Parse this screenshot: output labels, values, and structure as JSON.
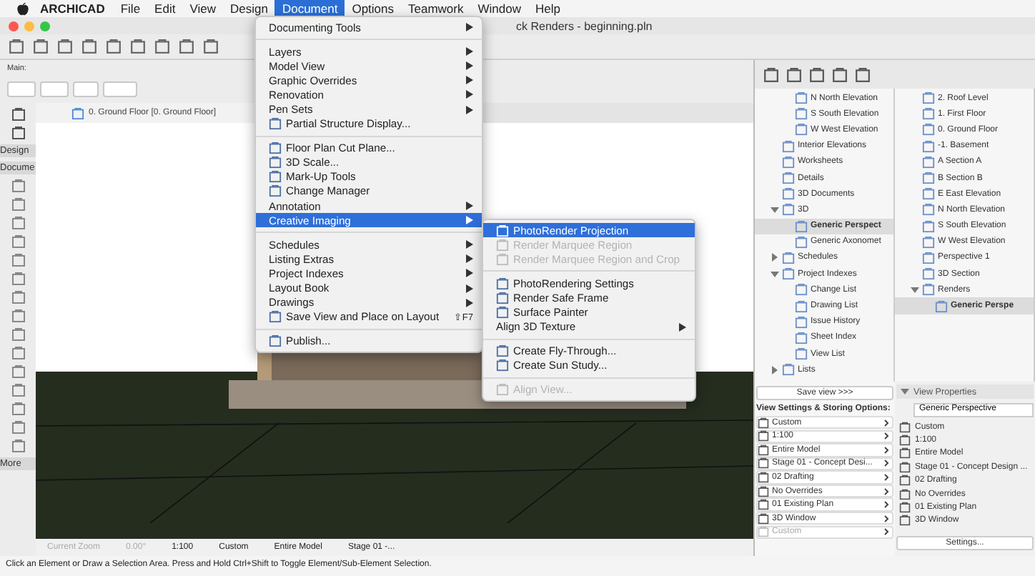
{
  "menubar": {
    "app": "ARCHICAD",
    "items": [
      {
        "label": "File",
        "selected": false
      },
      {
        "label": "Edit",
        "selected": false
      },
      {
        "label": "View",
        "selected": false
      },
      {
        "label": "Design",
        "selected": false
      },
      {
        "label": "Document",
        "selected": true
      },
      {
        "label": "Options",
        "selected": false
      },
      {
        "label": "Teamwork",
        "selected": false
      },
      {
        "label": "Window",
        "selected": false
      },
      {
        "label": "Help",
        "selected": false
      }
    ]
  },
  "window": {
    "title": "ck Renders - beginning.pln"
  },
  "toolbar": {
    "label": "Main:"
  },
  "toolbox": {
    "tabs": [
      "Design",
      "Docume"
    ],
    "more": "More"
  },
  "view_tab": {
    "label": "0. Ground Floor [0. Ground Floor]"
  },
  "nav_bar": {
    "items": [
      {
        "label": "Current Zoom",
        "disabled": true
      },
      {
        "label": "0.00°",
        "disabled": true
      },
      {
        "label": "1:100",
        "disabled": false
      },
      {
        "label": "Custom",
        "disabled": false
      },
      {
        "label": "Entire Model",
        "disabled": false
      },
      {
        "label": "Stage 01 -...",
        "disabled": false
      }
    ]
  },
  "status_bar": "Click an Element or Draw a Selection Area. Press and Hold Ctrl+Shift to Toggle Element/Sub-Element Selection.",
  "document_menu": {
    "items": [
      {
        "kind": "item",
        "label": "Documenting Tools",
        "submenu": true,
        "selected": false
      },
      {
        "kind": "separator"
      },
      {
        "kind": "item",
        "label": "Layers",
        "submenu": true,
        "selected": false
      },
      {
        "kind": "item",
        "label": "Model View",
        "submenu": true,
        "selected": false
      },
      {
        "kind": "item",
        "label": "Graphic Overrides",
        "submenu": true,
        "selected": false
      },
      {
        "kind": "item",
        "label": "Renovation",
        "submenu": true,
        "selected": false
      },
      {
        "kind": "item",
        "label": "Pen Sets",
        "submenu": true,
        "selected": false
      },
      {
        "kind": "icon_item",
        "label": "Partial Structure Display...",
        "submenu": false,
        "selected": false
      },
      {
        "kind": "separator"
      },
      {
        "kind": "icon_item",
        "label": "Floor Plan Cut Plane...",
        "submenu": false,
        "selected": false
      },
      {
        "kind": "icon_item",
        "label": "3D Scale...",
        "submenu": false,
        "selected": false
      },
      {
        "kind": "icon_item",
        "label": "Mark-Up Tools",
        "submenu": false,
        "selected": false
      },
      {
        "kind": "icon_item",
        "label": "Change Manager",
        "submenu": false,
        "selected": false
      },
      {
        "kind": "item",
        "label": "Annotation",
        "submenu": true,
        "selected": false
      },
      {
        "kind": "item",
        "label": "Creative Imaging",
        "submenu": true,
        "selected": true
      },
      {
        "kind": "separator"
      },
      {
        "kind": "item",
        "label": "Schedules",
        "submenu": true,
        "selected": false
      },
      {
        "kind": "item",
        "label": "Listing Extras",
        "submenu": true,
        "selected": false
      },
      {
        "kind": "item",
        "label": "Project Indexes",
        "submenu": true,
        "selected": false
      },
      {
        "kind": "item",
        "label": "Layout Book",
        "submenu": true,
        "selected": false
      },
      {
        "kind": "item",
        "label": "Drawings",
        "submenu": true,
        "selected": false
      },
      {
        "kind": "icon_item",
        "label": "Save View and Place on Layout",
        "submenu": false,
        "selected": false,
        "shortcut": "⇧F7"
      },
      {
        "kind": "separator"
      },
      {
        "kind": "icon_item",
        "label": "Publish...",
        "submenu": false,
        "selected": false
      }
    ]
  },
  "creative_imaging_submenu": {
    "items": [
      {
        "kind": "icon_item",
        "label": "PhotoRender Projection",
        "submenu": false,
        "selected": true,
        "disabled": false
      },
      {
        "kind": "icon_item",
        "label": "Render Marquee Region",
        "submenu": false,
        "selected": false,
        "disabled": true
      },
      {
        "kind": "icon_item",
        "label": "Render Marquee Region and Crop",
        "submenu": false,
        "selected": false,
        "disabled": true
      },
      {
        "kind": "separator"
      },
      {
        "kind": "icon_item",
        "label": "PhotoRendering Settings",
        "submenu": false,
        "selected": false,
        "disabled": false
      },
      {
        "kind": "icon_item",
        "label": "Render Safe Frame",
        "submenu": false,
        "selected": false,
        "disabled": false
      },
      {
        "kind": "icon_item",
        "label": "Surface Painter",
        "submenu": false,
        "selected": false,
        "disabled": false
      },
      {
        "kind": "item",
        "label": "Align 3D Texture",
        "submenu": true,
        "selected": false,
        "disabled": false
      },
      {
        "kind": "separator"
      },
      {
        "kind": "icon_item",
        "label": "Create Fly-Through...",
        "submenu": false,
        "selected": false,
        "disabled": false
      },
      {
        "kind": "icon_item",
        "label": "Create Sun Study...",
        "submenu": false,
        "selected": false,
        "disabled": false
      },
      {
        "kind": "separator"
      },
      {
        "kind": "icon_item",
        "label": "Align View...",
        "submenu": false,
        "selected": false,
        "disabled": true
      }
    ]
  },
  "view_map": {
    "continued": [
      {
        "label": "N North Elevation",
        "selected": false
      },
      {
        "label": "S South Elevation",
        "selected": false
      },
      {
        "label": "W West Elevation",
        "selected": false
      }
    ],
    "items": [
      {
        "label": "Interior Elevations",
        "selected": false
      },
      {
        "label": "Worksheets",
        "selected": false
      },
      {
        "label": "Details",
        "selected": false
      },
      {
        "label": "3D Documents",
        "selected": false
      },
      {
        "label": "3D",
        "selected": false,
        "expanded": true,
        "children": [
          {
            "label": "Generic Perspect",
            "selected": true
          },
          {
            "label": "Generic Axonomet",
            "selected": false
          }
        ]
      },
      {
        "label": "Schedules",
        "selected": false,
        "expanded": false
      },
      {
        "label": "Project Indexes",
        "selected": false,
        "expanded": true,
        "children": [
          {
            "label": "Change List",
            "selected": false
          },
          {
            "label": "Drawing List",
            "selected": false
          },
          {
            "label": "Issue History",
            "selected": false
          },
          {
            "label": "Sheet Index",
            "selected": false
          },
          {
            "label": "View List",
            "selected": false
          }
        ]
      },
      {
        "label": "Lists",
        "selected": false,
        "expanded": false
      }
    ]
  },
  "project_map": {
    "continued": [
      {
        "label": "2. Roof Level",
        "selected": false
      },
      {
        "label": "1. First Floor",
        "selected": false
      },
      {
        "label": "0. Ground Floor",
        "selected": false
      },
      {
        "label": "-1. Basement",
        "selected": false
      },
      {
        "label": "A Section A",
        "selected": false
      },
      {
        "label": "B Section B",
        "selected": false
      },
      {
        "label": "E East Elevation",
        "selected": false
      },
      {
        "label": "N North Elevation",
        "selected": false
      },
      {
        "label": "S South Elevation",
        "selected": false
      },
      {
        "label": "W West Elevation",
        "selected": false
      },
      {
        "label": "Perspective 1",
        "selected": false
      },
      {
        "label": "3D Section",
        "selected": false
      },
      {
        "label": "Renders",
        "selected": false,
        "expanded": true,
        "children": [
          {
            "label": "Generic Perspe",
            "selected": true
          }
        ]
      }
    ]
  },
  "save_view_button": "Save view >>>",
  "storing_options": {
    "title": "View Settings & Storing Options:",
    "rows": [
      {
        "label": "Custom",
        "disabled": false
      },
      {
        "label": "1:100",
        "disabled": false
      },
      {
        "label": "Entire Model",
        "disabled": false
      },
      {
        "label": "Stage 01 - Concept Desi...",
        "disabled": false
      },
      {
        "label": "02 Drafting",
        "disabled": false
      },
      {
        "label": "No Overrides",
        "disabled": false
      },
      {
        "label": "01 Existing Plan",
        "disabled": false
      },
      {
        "label": "3D Window",
        "disabled": false
      },
      {
        "label": "Custom",
        "disabled": true
      }
    ]
  },
  "view_properties": {
    "title": "View Properties",
    "expanded": true,
    "name": "Generic Perspective",
    "rows": [
      "Custom",
      "1:100",
      "Entire Model",
      "Stage 01 - Concept Design ...",
      "02 Drafting",
      "No Overrides",
      "01 Existing Plan",
      "3D Window"
    ],
    "settings_button": "Settings..."
  }
}
